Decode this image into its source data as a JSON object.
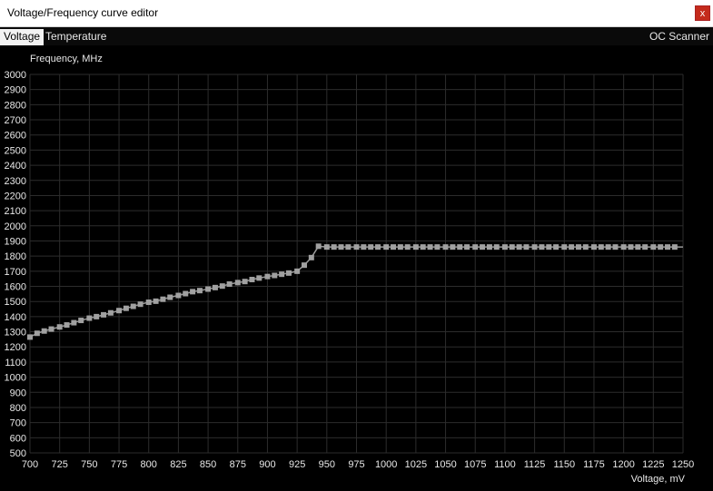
{
  "window": {
    "title": "Voltage/Frequency curve editor",
    "close_label": "x"
  },
  "tabs": [
    {
      "label": "Voltage",
      "active": true
    },
    {
      "label": "Temperature",
      "active": false
    }
  ],
  "oc_scanner_label": "OC Scanner",
  "colors": {
    "background": "#000000",
    "grid": "#2c2c2c",
    "curve": "#9a9a9a",
    "title_bar": "#ffffff",
    "close": "#c42b1c"
  },
  "chart_data": {
    "type": "line",
    "ylabel": "Frequency, MHz",
    "xlabel": "Voltage, mV",
    "xlim": [
      700,
      1250
    ],
    "ylim": [
      500,
      3000
    ],
    "x_ticks": [
      700,
      725,
      750,
      775,
      800,
      825,
      850,
      875,
      900,
      925,
      950,
      975,
      1000,
      1025,
      1050,
      1075,
      1100,
      1125,
      1150,
      1175,
      1200,
      1225,
      1250
    ],
    "y_ticks": [
      3000,
      2900,
      2800,
      2700,
      2600,
      2500,
      2400,
      2300,
      2200,
      2100,
      2000,
      1900,
      1800,
      1700,
      1600,
      1500,
      1400,
      1300,
      1200,
      1100,
      1000,
      900,
      800,
      700,
      600,
      500
    ],
    "grid": true,
    "series": [
      {
        "x": [
          700,
          706,
          712,
          718,
          725,
          731,
          737,
          743,
          750,
          756,
          762,
          768,
          775,
          781,
          787,
          793,
          800,
          806,
          812,
          818,
          825,
          831,
          837,
          843,
          850,
          856,
          862,
          868,
          875,
          881,
          887,
          893,
          900,
          906,
          912,
          918,
          925,
          931,
          937,
          943,
          950,
          956,
          962,
          968,
          975,
          981,
          987,
          993,
          1000,
          1006,
          1012,
          1018,
          1025,
          1031,
          1037,
          1043,
          1050,
          1056,
          1062,
          1068,
          1075,
          1081,
          1087,
          1093,
          1100,
          1106,
          1112,
          1118,
          1125,
          1131,
          1137,
          1143,
          1150,
          1156,
          1162,
          1168,
          1175,
          1181,
          1187,
          1193,
          1200,
          1206,
          1212,
          1218,
          1225,
          1231,
          1237,
          1243
        ],
        "y": [
          1265,
          1290,
          1305,
          1318,
          1332,
          1345,
          1360,
          1375,
          1390,
          1400,
          1412,
          1425,
          1440,
          1455,
          1468,
          1482,
          1495,
          1502,
          1515,
          1528,
          1540,
          1552,
          1565,
          1572,
          1582,
          1592,
          1602,
          1615,
          1625,
          1632,
          1645,
          1655,
          1665,
          1672,
          1680,
          1688,
          1700,
          1740,
          1790,
          1865,
          1860,
          1860,
          1860,
          1860,
          1860,
          1860,
          1860,
          1860,
          1860,
          1860,
          1860,
          1860,
          1860,
          1860,
          1860,
          1860,
          1860,
          1860,
          1860,
          1860,
          1860,
          1860,
          1860,
          1860,
          1860,
          1860,
          1860,
          1860,
          1860,
          1860,
          1860,
          1860,
          1860,
          1860,
          1860,
          1860,
          1860,
          1860,
          1860,
          1860,
          1860,
          1860,
          1860,
          1860,
          1860,
          1860,
          1860,
          1860
        ]
      }
    ]
  }
}
